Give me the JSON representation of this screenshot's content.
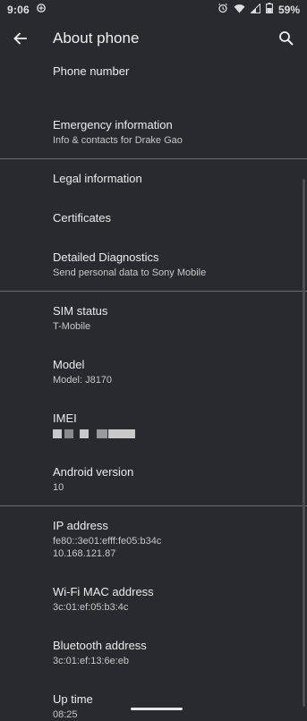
{
  "status_bar": {
    "time": "9:06",
    "battery": "59%"
  },
  "header": {
    "title": "About phone"
  },
  "items": [
    {
      "title": "Phone number"
    },
    {
      "title": "Emergency information",
      "subtitle": "Info & contacts for Drake Gao"
    },
    {
      "title": "Legal information"
    },
    {
      "title": "Certificates"
    },
    {
      "title": "Detailed Diagnostics",
      "subtitle": "Send personal data to Sony Mobile"
    },
    {
      "title": "SIM status",
      "subtitle": "T-Mobile"
    },
    {
      "title": "Model",
      "subtitle": "Model: J8170"
    },
    {
      "title": "IMEI"
    },
    {
      "title": "Android version",
      "subtitle": "10"
    },
    {
      "title": "IP address",
      "subtitle": "fe80::3e01:efff:fe05:b34c",
      "subtitle2": "10.168.121.87"
    },
    {
      "title": "Wi-Fi MAC address",
      "subtitle": "3c:01:ef:05:b3:4c"
    },
    {
      "title": "Bluetooth address",
      "subtitle": "3c:01:ef:13:6e:eb"
    },
    {
      "title": "Up time",
      "subtitle": "08:25"
    }
  ],
  "colors": {
    "background": "#272a2e",
    "divider": "#6a6d71",
    "text": "#ececec",
    "secondary_text": "#c8c8c8"
  },
  "icons": [
    "sync-icon",
    "alarm-icon",
    "wifi-icon",
    "signal-icon",
    "battery-icon",
    "back-arrow-icon",
    "search-icon"
  ]
}
